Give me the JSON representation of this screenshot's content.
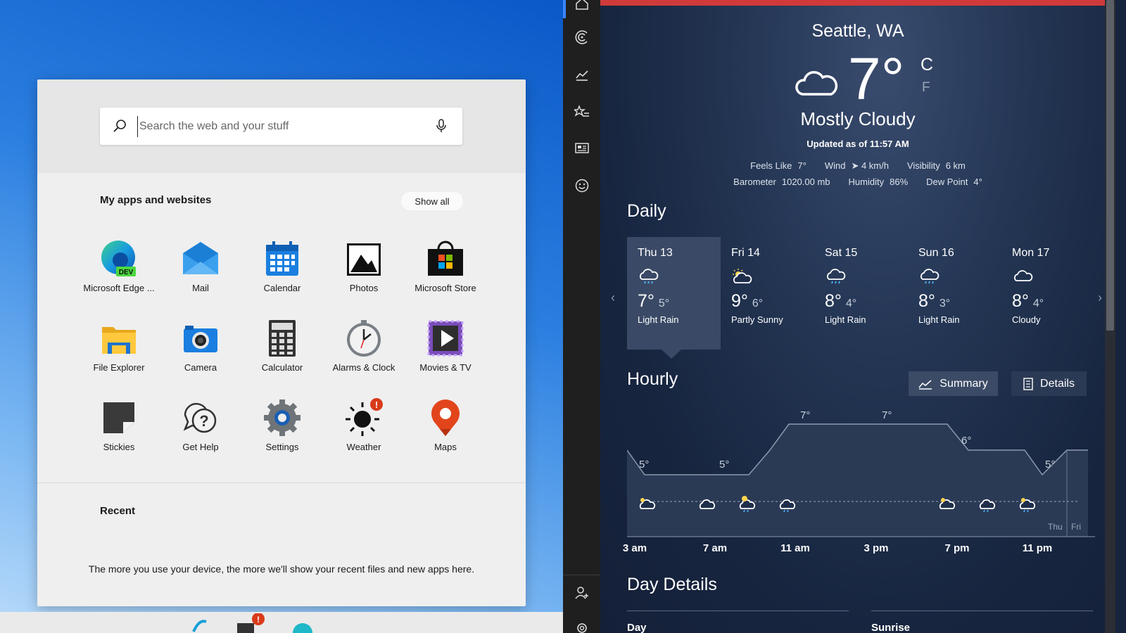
{
  "start": {
    "search": {
      "placeholder": "Search the web and your stuff"
    },
    "apps_title": "My apps and websites",
    "show_all": "Show all",
    "apps": [
      {
        "label": "Microsoft Edge ...",
        "icon": "edge-dev-icon",
        "badge": "DEV"
      },
      {
        "label": "Mail",
        "icon": "mail-icon"
      },
      {
        "label": "Calendar",
        "icon": "calendar-icon"
      },
      {
        "label": "Photos",
        "icon": "photos-icon"
      },
      {
        "label": "Microsoft Store",
        "icon": "store-icon"
      },
      {
        "label": "File Explorer",
        "icon": "folder-icon"
      },
      {
        "label": "Camera",
        "icon": "camera-icon"
      },
      {
        "label": "Calculator",
        "icon": "calculator-icon"
      },
      {
        "label": "Alarms & Clock",
        "icon": "clock-icon"
      },
      {
        "label": "Movies & TV",
        "icon": "movies-icon"
      },
      {
        "label": "Stickies",
        "icon": "stickies-icon"
      },
      {
        "label": "Get Help",
        "icon": "help-icon"
      },
      {
        "label": "Settings",
        "icon": "gear-icon"
      },
      {
        "label": "Weather",
        "icon": "weather-sun-icon",
        "badge": "!"
      },
      {
        "label": "Maps",
        "icon": "map-pin-icon"
      }
    ],
    "recent_title": "Recent",
    "recent_message": "The more you use your device, the more we'll show your recent files and new apps here."
  },
  "weather": {
    "city": "Seattle, WA",
    "temp": "7°",
    "unit_c": "C",
    "unit_f": "F",
    "condition": "Mostly Cloudy",
    "updated": "Updated as of 11:57 AM",
    "details_row1": [
      {
        "label": "Feels Like",
        "value": "7°"
      },
      {
        "label": "Wind",
        "value": "➤ 4 km/h"
      },
      {
        "label": "Visibility",
        "value": "6 km"
      }
    ],
    "details_row2": [
      {
        "label": "Barometer",
        "value": "1020.00 mb"
      },
      {
        "label": "Humidity",
        "value": "86%"
      },
      {
        "label": "Dew Point",
        "value": "4°"
      }
    ],
    "daily_title": "Daily",
    "daily": [
      {
        "day": "Thu 13",
        "hi": "7°",
        "lo": "5°",
        "cond": "Light Rain",
        "icon": "rain-icon"
      },
      {
        "day": "Fri 14",
        "hi": "9°",
        "lo": "6°",
        "cond": "Partly Sunny",
        "icon": "partly-sunny-icon"
      },
      {
        "day": "Sat 15",
        "hi": "8°",
        "lo": "4°",
        "cond": "Light Rain",
        "icon": "rain-icon"
      },
      {
        "day": "Sun 16",
        "hi": "8°",
        "lo": "3°",
        "cond": "Light Rain",
        "icon": "rain-icon"
      },
      {
        "day": "Mon 17",
        "hi": "8°",
        "lo": "4°",
        "cond": "Cloudy",
        "icon": "cloud-icon"
      }
    ],
    "hourly_title": "Hourly",
    "summary_label": "Summary",
    "details_label": "Details",
    "hourly_temp_labels": [
      "5°",
      "5°",
      "7°",
      "7°",
      "6°",
      "5°"
    ],
    "hourly_times": [
      "3 am",
      "7 am",
      "11 am",
      "3 pm",
      "7 pm",
      "11 pm"
    ],
    "day_markers": [
      "Thu",
      "Fri"
    ],
    "day_details_title": "Day Details",
    "day_details_day": "Day",
    "day_details_sunrise": "Sunrise"
  },
  "colors": {
    "accent_red": "#d03a3a",
    "nav_selected": "#3a86ff",
    "selected_day": "#3a4a66"
  }
}
